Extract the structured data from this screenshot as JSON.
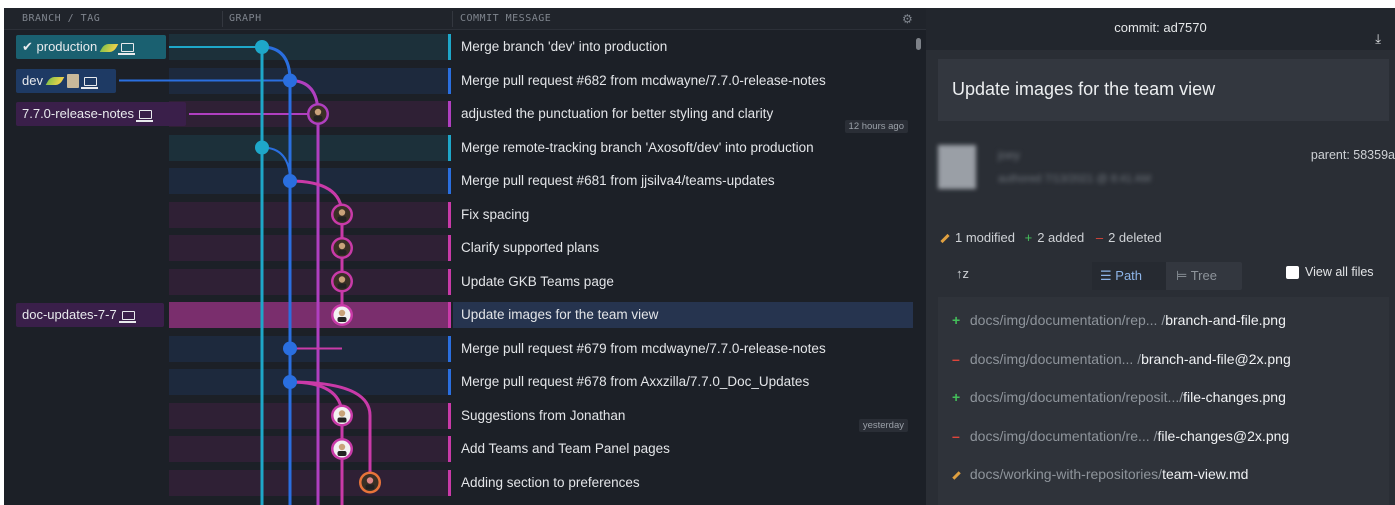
{
  "header": {
    "branch_col": "BRANCH / TAG",
    "graph_col": "GRAPH",
    "message_col": "COMMIT MESSAGE"
  },
  "branches": [
    {
      "label": "production",
      "checked": true,
      "row": 0,
      "color": "#1a6070"
    },
    {
      "label": "dev",
      "row": 1,
      "color": "#1e3a64"
    },
    {
      "label": "7.7.0-release-notes",
      "row": 2,
      "color": "#3a1f4a"
    },
    {
      "label": "doc-updates-7-7",
      "row": 8,
      "color": "#3a1f4a"
    }
  ],
  "commits": [
    {
      "message": "Merge branch 'dev' into production",
      "accent": "#1ea7c9"
    },
    {
      "message": "Merge pull request #682 from mcdwayne/7.7.0-release-notes",
      "accent": "#2a6fe0"
    },
    {
      "message": "adjusted the punctuation for better styling and clarity",
      "accent": "#b03fc0",
      "time": "12 hours ago"
    },
    {
      "message": "Merge remote-tracking branch 'Axosoft/dev' into production",
      "accent": "#1ea7c9"
    },
    {
      "message": "Merge pull request #681 from jjsilva4/teams-updates",
      "accent": "#2a6fe0"
    },
    {
      "message": "Fix spacing",
      "accent": "#c93aa8"
    },
    {
      "message": "Clarify supported plans",
      "accent": "#c93aa8"
    },
    {
      "message": "Update GKB Teams page",
      "accent": "#c93aa8"
    },
    {
      "message": "Update images for the team view",
      "accent": "#c93aa8",
      "selected": true
    },
    {
      "message": "Merge pull request #679 from mcdwayne/7.7.0-release-notes",
      "accent": "#2a6fe0"
    },
    {
      "message": "Merge pull request #678 from Axxzilla/7.7.0_Doc_Updates",
      "accent": "#2a6fe0"
    },
    {
      "message": "Suggestions from Jonathan",
      "accent": "#c93aa8",
      "time": "yesterday"
    },
    {
      "message": "Add Teams and Team Panel pages",
      "accent": "#c93aa8"
    },
    {
      "message": "Adding section to preferences",
      "accent": "#c93aa8"
    }
  ],
  "detail": {
    "commit_label": "commit: ad7570",
    "title": "Update images for the team view",
    "author": "joey",
    "authored": "authored 7/13/2021 @ 8:41 AM",
    "parent": "parent: 58359a",
    "modified": "1 modified",
    "added": "2 added",
    "deleted": "2 deleted",
    "view_path": "Path",
    "view_tree": "Tree",
    "view_all": "View all files",
    "files": [
      {
        "status": "added",
        "path": "docs/img/documentation/rep... /",
        "name": "branch-and-file.png"
      },
      {
        "status": "deleted",
        "path": "docs/img/documentation... /",
        "name": "branch-and-file@2x.png"
      },
      {
        "status": "added",
        "path": "docs/img/documentation/reposit.../",
        "name": "file-changes.png"
      },
      {
        "status": "deleted",
        "path": "docs/img/documentation/re... /",
        "name": "file-changes@2x.png"
      },
      {
        "status": "modified",
        "path": "docs/working-with-repositories/",
        "name": "team-view.md"
      }
    ]
  },
  "colors": {
    "teal": "#1ea7c9",
    "blue": "#2a6fe0",
    "purple": "#b03fc0",
    "magenta": "#c93aa8",
    "orange": "#e8743a"
  }
}
